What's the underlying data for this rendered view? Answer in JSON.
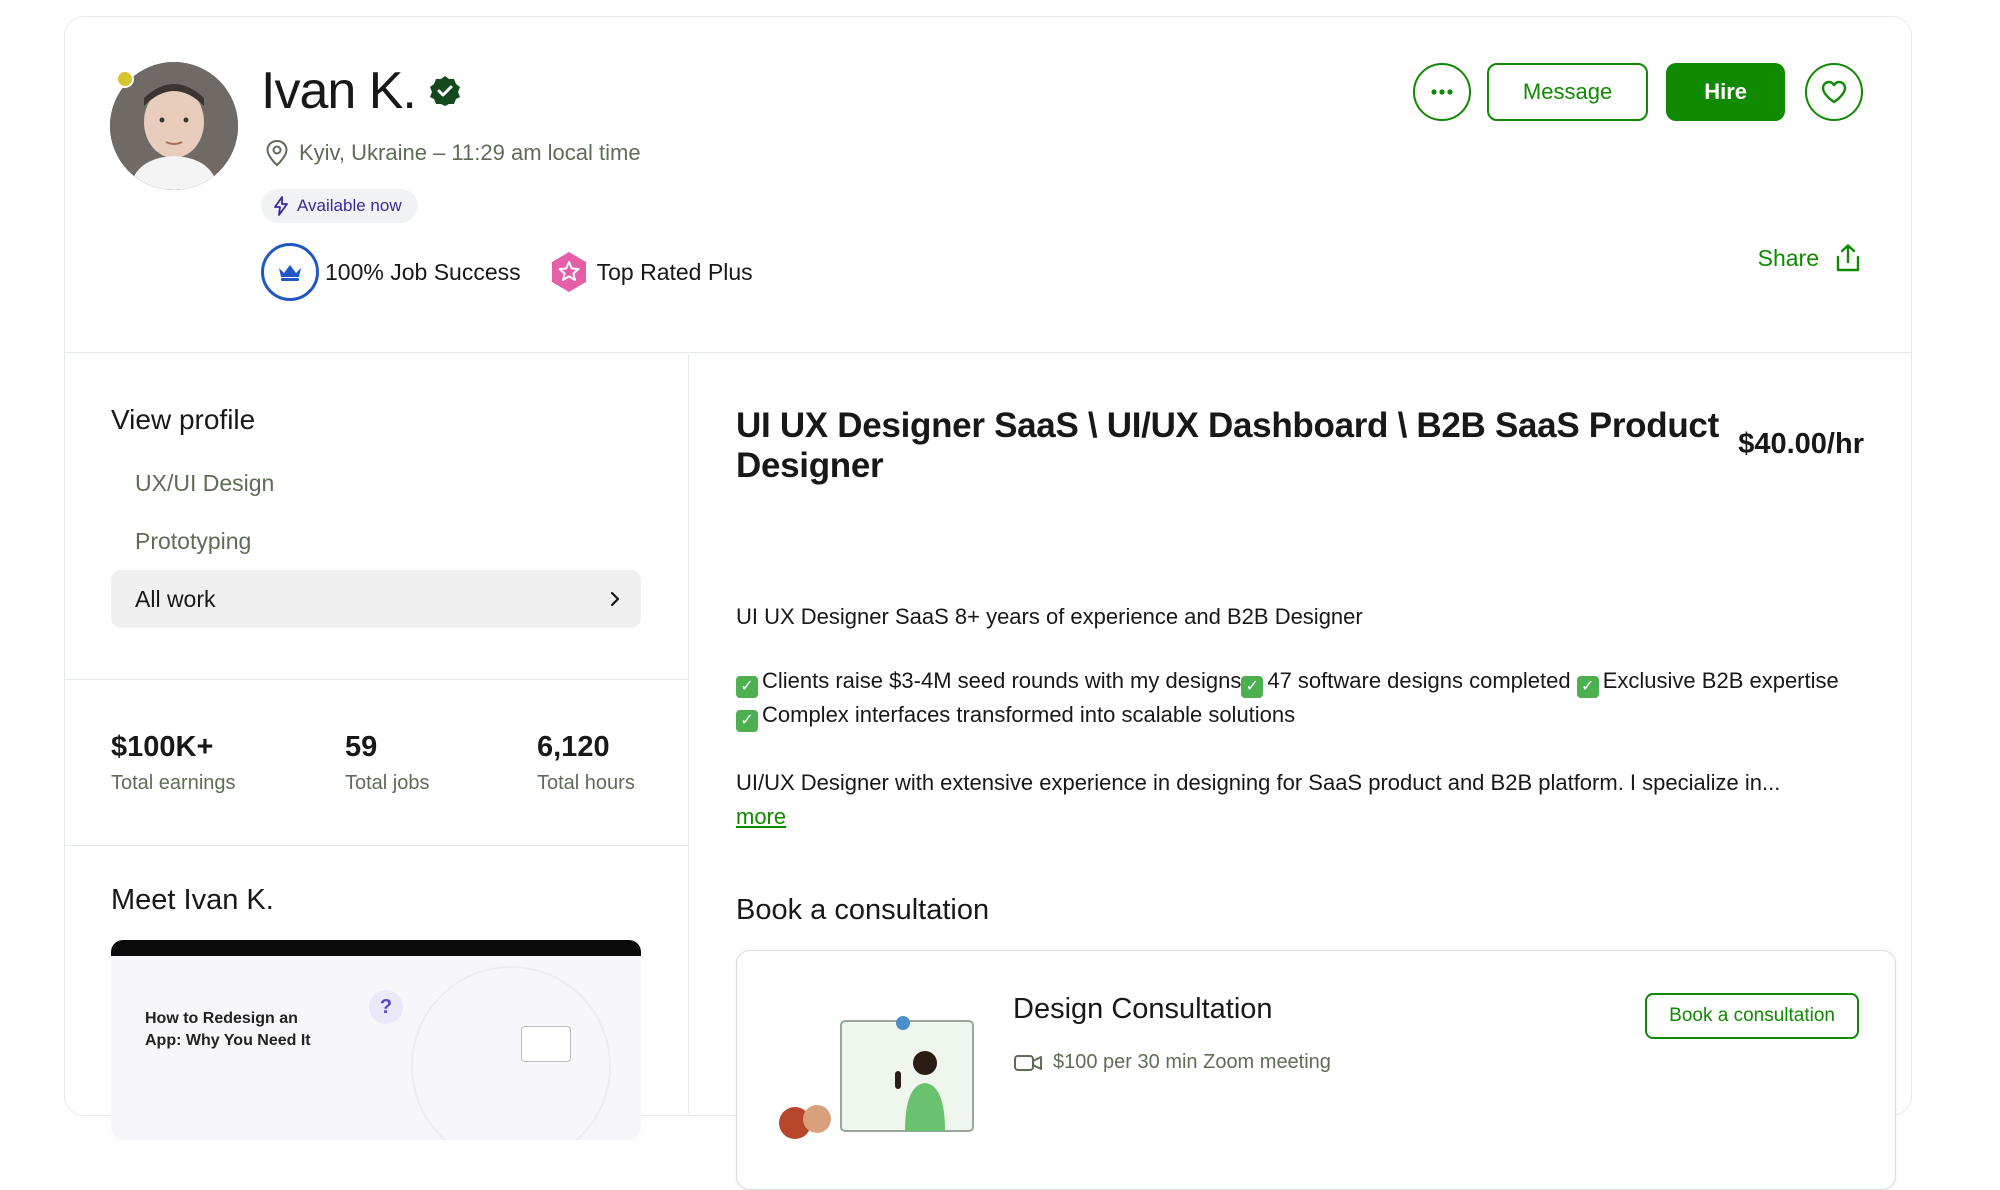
{
  "profile": {
    "name": "Ivan K.",
    "location": "Kyiv, Ukraine – 11:29 am local time",
    "availability": "Available now",
    "job_success": "100% Job Success",
    "top_rated": "Top Rated Plus"
  },
  "actions": {
    "message_label": "Message",
    "hire_label": "Hire",
    "share_label": "Share"
  },
  "view_profile": {
    "title": "View profile",
    "items": [
      {
        "label": "UX/UI Design"
      },
      {
        "label": "Prototyping"
      },
      {
        "label": "All work"
      }
    ]
  },
  "stats": [
    {
      "value": "$100K+",
      "label": "Total earnings"
    },
    {
      "value": "59",
      "label": "Total jobs"
    },
    {
      "value": "6,120",
      "label": "Total hours"
    }
  ],
  "meet": {
    "title": "Meet Ivan K.",
    "video_title_line1": "How to Redesign an",
    "video_title_line2": "App: Why You Need It",
    "video_badge": "?"
  },
  "main": {
    "title": "UI UX Designer SaaS \\ UI/UX Dashboard \\ B2B SaaS Product Designer",
    "rate": "$40.00/hr",
    "intro": "UI UX Designer SaaS 8+ years of experience and B2B Designer",
    "highlight_1": "Clients raise $3-4M seed rounds with my designs",
    "highlight_2": "47 software designs completed",
    "highlight_3": "Exclusive B2B expertise",
    "highlight_4": "Complex interfaces transformed into scalable solutions",
    "summary": "UI/UX Designer with extensive experience in designing for SaaS product and B2B platform. I specialize in...",
    "more_label": "more"
  },
  "consultation": {
    "section_title": "Book a consultation",
    "name": "Design Consultation",
    "meta": "$100 per 30 min Zoom meeting",
    "button_label": "Book a consultation"
  },
  "colors": {
    "brand_green": "#108a00",
    "online_dot": "#d7c62a",
    "jss_blue": "#1f57c3",
    "top_rated_pink": "#e55ea8",
    "available_purple": "#3c2a95"
  },
  "icons": {
    "verified": "verified-badge-icon",
    "location": "location-pin-icon",
    "lightning": "lightning-icon",
    "crown": "crown-icon",
    "star_badge": "star-badge-icon",
    "more": "more-dots-icon",
    "heart": "heart-icon",
    "share": "share-icon",
    "chevron": "chevron-right-icon",
    "video": "video-camera-icon",
    "check": "check-box-icon"
  }
}
